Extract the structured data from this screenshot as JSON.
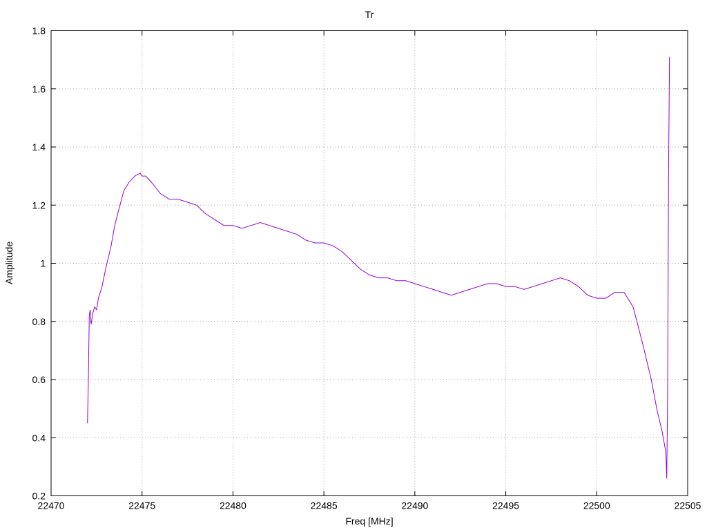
{
  "chart_data": {
    "type": "line",
    "title": "Tr",
    "xlabel": "Freq [MHz]",
    "ylabel": "Amplitude",
    "xlim": [
      22470,
      22505
    ],
    "ylim": [
      0.2,
      1.8
    ],
    "x_ticks": [
      "22470",
      "22475",
      "22480",
      "22485",
      "22490",
      "22495",
      "22500",
      "22505"
    ],
    "y_ticks": [
      "0.2",
      "0.4",
      "0.6",
      "0.8",
      "1",
      "1.2",
      "1.4",
      "1.6",
      "1.8"
    ],
    "grid": true,
    "series": [
      {
        "color": "#9400d3",
        "x": [
          22472.0,
          22472.05,
          22472.1,
          22472.15,
          22472.2,
          22472.3,
          22472.4,
          22472.5,
          22472.6,
          22472.8,
          22473.0,
          22473.3,
          22473.5,
          22473.7,
          22474.0,
          22474.3,
          22474.6,
          22474.9,
          22475.0,
          22475.2,
          22475.5,
          22476.0,
          22476.5,
          22477.0,
          22477.5,
          22478.0,
          22478.5,
          22479.0,
          22479.5,
          22480.0,
          22480.5,
          22481.0,
          22481.5,
          22482.0,
          22482.5,
          22483.0,
          22483.5,
          22484.0,
          22484.5,
          22485.0,
          22485.5,
          22486.0,
          22486.5,
          22487.0,
          22487.5,
          22488.0,
          22488.5,
          22489.0,
          22489.5,
          22490.0,
          22490.5,
          22491.0,
          22491.5,
          22492.0,
          22492.5,
          22493.0,
          22493.5,
          22494.0,
          22494.5,
          22495.0,
          22495.5,
          22496.0,
          22496.5,
          22497.0,
          22497.5,
          22498.0,
          22498.5,
          22499.0,
          22499.5,
          22500.0,
          22500.5,
          22501.0,
          22501.5,
          22502.0,
          22502.5,
          22503.0,
          22503.3,
          22503.6,
          22503.8,
          22503.85,
          22503.9,
          22503.95,
          22504.0
        ],
        "y": [
          0.45,
          0.6,
          0.82,
          0.84,
          0.79,
          0.83,
          0.85,
          0.84,
          0.88,
          0.92,
          0.98,
          1.06,
          1.13,
          1.18,
          1.25,
          1.28,
          1.3,
          1.31,
          1.3,
          1.3,
          1.28,
          1.24,
          1.22,
          1.22,
          1.21,
          1.2,
          1.17,
          1.15,
          1.13,
          1.13,
          1.12,
          1.13,
          1.14,
          1.13,
          1.12,
          1.11,
          1.1,
          1.08,
          1.07,
          1.07,
          1.06,
          1.04,
          1.01,
          0.98,
          0.96,
          0.95,
          0.95,
          0.94,
          0.94,
          0.93,
          0.92,
          0.91,
          0.9,
          0.89,
          0.9,
          0.91,
          0.92,
          0.93,
          0.93,
          0.92,
          0.92,
          0.91,
          0.92,
          0.93,
          0.94,
          0.95,
          0.94,
          0.92,
          0.89,
          0.88,
          0.88,
          0.9,
          0.9,
          0.85,
          0.73,
          0.6,
          0.5,
          0.42,
          0.35,
          0.26,
          0.55,
          1.3,
          1.71
        ]
      }
    ]
  }
}
